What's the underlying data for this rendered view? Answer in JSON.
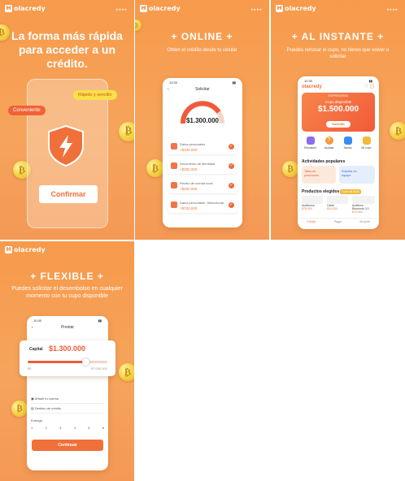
{
  "brand": "olacredy",
  "brand_mark": "H",
  "arrows": "▸▸▸▸",
  "coin_glyph": "₿",
  "panel1": {
    "headline": "La forma más rápida para acceder a un crédito.",
    "tag_left": "Conveniente",
    "tag_right": "Rápido y sencillo",
    "button": "Confirmar",
    "icon": "shield-bolt-icon"
  },
  "panel2": {
    "headline": "+ ONLINE +",
    "sub": "Obten el crédito desde tu celular",
    "time": "10:30",
    "screen_title": "Solicitar",
    "amount": "$1.300.000",
    "rows": [
      {
        "title": "Datos personales",
        "amount": "+$200.000"
      },
      {
        "title": "Documento de identidad",
        "amount": "+$200.000"
      },
      {
        "title": "Recibo de cuenta local",
        "amount": "+$200.000"
      },
      {
        "title": "Datos personales: Seleccionar",
        "amount": "+$700.000"
      }
    ]
  },
  "panel3": {
    "headline": "+ AL INSTANTE +",
    "sub": "Puedes rehusar el cupo, no tienes que volver a solicitar",
    "time": "10:30",
    "badge": "EMPRESARIAL",
    "cupo_label": "Cupo disponible",
    "amount": "$1.500.000",
    "solicitar": "Solicitar",
    "quick": [
      {
        "label": "Simulador",
        "icon": "calculator-icon"
      },
      {
        "label": "Ayudas",
        "icon": "help-icon"
      },
      {
        "label": "Tareas",
        "icon": "tasks-icon"
      },
      {
        "label": "Mi cupo",
        "icon": "limit-icon"
      }
    ],
    "popular_title": "Actividades populares",
    "popular": [
      {
        "label": "Tabla de posiciones"
      },
      {
        "label": "Solicitar en equipo"
      }
    ],
    "products_title": "Productos elegidos",
    "products_tag": "Cupo de $100",
    "products": [
      {
        "name": "Audifonos",
        "price": "$78.000"
      },
      {
        "name": "Cable",
        "price": "$19.000"
      },
      {
        "name": "Audifono Bluetooth 3.0",
        "price": "$70.000"
      }
    ],
    "nav": [
      "Crédito",
      "Pagar",
      "Mi perfil"
    ]
  },
  "panel4": {
    "headline": "+ FLEXIBLE +",
    "sub": "Puedes solicitar el desembolso en cualquier momento con tu cupo disponible",
    "time": "10:30",
    "screen_title": "Prestar",
    "capital_label": "Capital",
    "capital_value": "$1.300.000",
    "slider_fraction": 0.72,
    "slider_min": "$0",
    "slider_max": "$7.000.000",
    "account_label": "Añadir tu cuenta",
    "destination_label": "Destino de crédito",
    "plazo_label": "Entrega",
    "plazos": [
      "1",
      "2",
      "3",
      "4",
      "5",
      "6"
    ],
    "continue": "Continuar"
  }
}
